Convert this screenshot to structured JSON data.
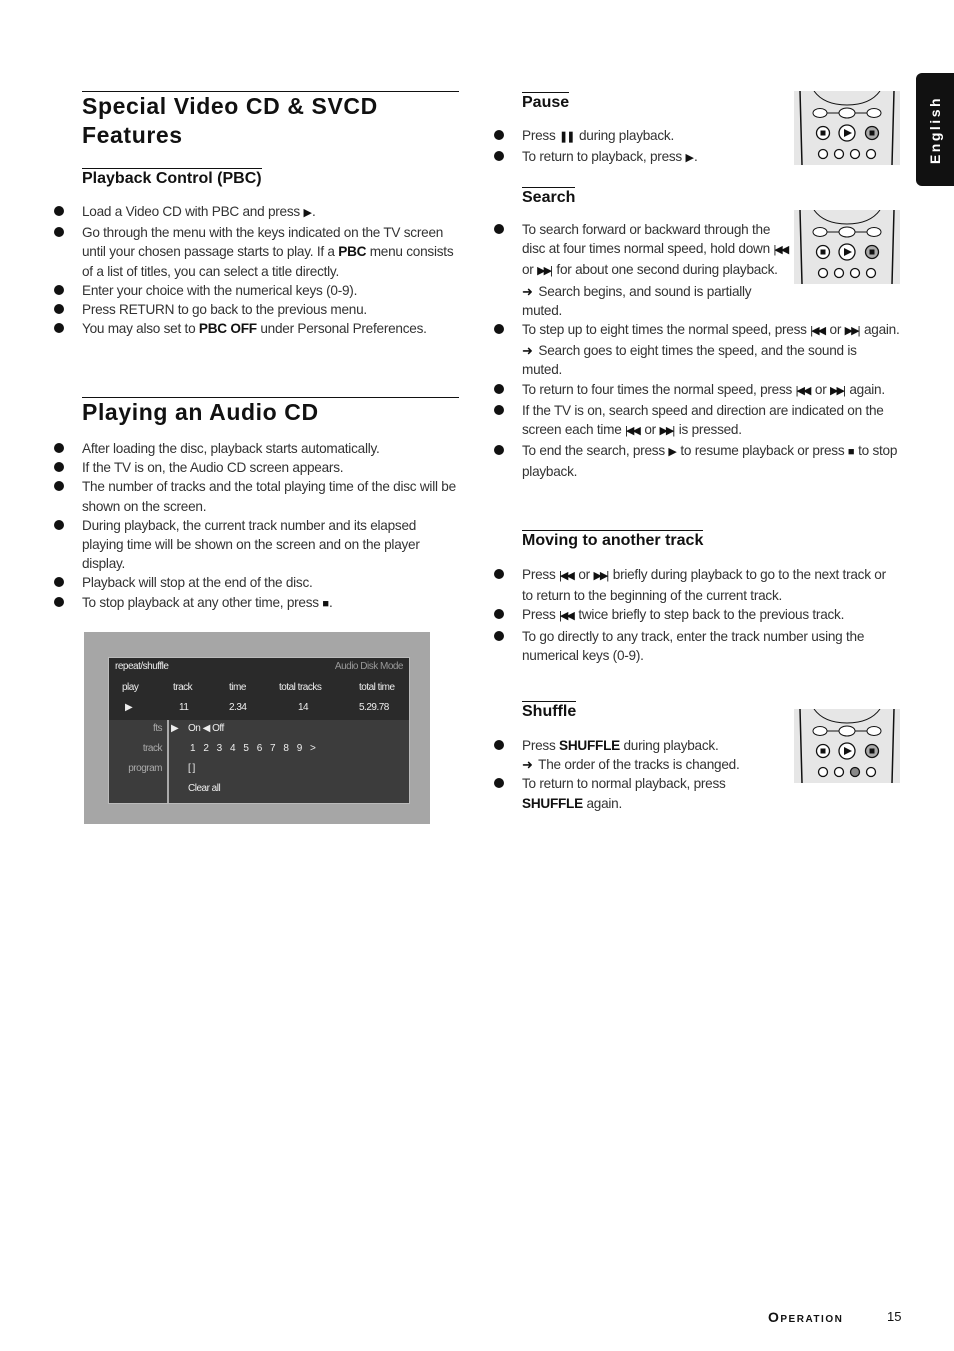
{
  "side_tab": "English",
  "left": {
    "pbc_section": {
      "title": "Special Video CD & SVCD Features",
      "subtitle": "Playback Control (PBC)",
      "items": [
        [
          [
            "Load a Video CD with PBC and press "
          ],
          {
            "icon": "play"
          },
          [
            "."
          ]
        ],
        [
          [
            "Go through the menu with the keys indicated on the TV screen until your chosen passage starts to play. If a "
          ],
          {
            "b": "PBC"
          },
          [
            " menu consists of a list of titles, you can select a title directly."
          ]
        ],
        [
          [
            "Enter your choice with the numerical keys (0-9)."
          ]
        ],
        [
          [
            "Press RETURN to go back to the previous menu."
          ]
        ],
        [
          [
            "You may also set to "
          ],
          {
            "b": "PBC OFF"
          },
          [
            " under Personal Preferences."
          ]
        ]
      ]
    },
    "audio_section": {
      "title": "Playing an Audio CD",
      "items": [
        [
          [
            "After loading the disc, playback starts automatically."
          ]
        ],
        [
          [
            "If the TV is on, the Audio CD screen appears."
          ]
        ],
        [
          [
            "The number of tracks and the total playing time of the disc will be shown on the screen."
          ]
        ],
        [
          [
            "During playback, the current track number and its elapsed playing time will be shown on the screen and on the player display."
          ]
        ],
        [
          [
            "Playback will stop at the end of the disc."
          ]
        ],
        [
          [
            "To stop playback at any other time, press "
          ],
          {
            "icon": "stop"
          },
          [
            "."
          ]
        ]
      ]
    },
    "osd": {
      "header": "repeat/shuffle",
      "mode": "Audio Disk Mode",
      "columns": [
        "play",
        "track",
        "time",
        "total tracks",
        "total time"
      ],
      "values": {
        "track": "11",
        "time": "2.34",
        "total_tracks": "14",
        "total_time": "5.29.78"
      },
      "rows": {
        "fts_label": "fts",
        "fts_value": "On ◀ Off",
        "track_label": "track",
        "tracks": [
          "1",
          "2",
          "3",
          "4",
          "5",
          "6",
          "7",
          "8",
          "9",
          ">"
        ],
        "program_label": "program",
        "program_value": "[ ]",
        "clear": "Clear all"
      }
    }
  },
  "right": {
    "pause": {
      "title": "Pause",
      "items": [
        [
          [
            "Press "
          ],
          {
            "icon": "pause"
          },
          [
            " during playback."
          ]
        ],
        [
          [
            "To return to playback, press "
          ],
          {
            "icon": "play"
          },
          [
            "."
          ]
        ]
      ]
    },
    "search": {
      "title": "Search",
      "items": [
        [
          [
            "To search forward or backward through the disc at four times normal speed, hold down "
          ],
          {
            "icon": "prev"
          },
          [
            " or "
          ],
          {
            "icon": "next"
          },
          [
            " for about one second during playback."
          ],
          {
            "br": 1
          },
          {
            "icon": "arrow"
          },
          [
            " Search begins, and sound is partially muted."
          ]
        ],
        [
          [
            "To step up to eight times the normal speed, press "
          ],
          {
            "icon": "prev"
          },
          [
            " or "
          ],
          {
            "icon": "next"
          },
          [
            " again."
          ],
          {
            "br": 1
          },
          {
            "icon": "arrow"
          },
          [
            " Search goes to eight times the speed, and the sound is muted."
          ]
        ],
        [
          [
            "To return to four times the normal speed, press "
          ],
          {
            "icon": "prev"
          },
          [
            " or "
          ],
          {
            "icon": "next"
          },
          [
            " again."
          ]
        ],
        [
          [
            "If the TV is on, search speed and direction are indicated on the screen each time "
          ],
          {
            "icon": "prev"
          },
          [
            " or "
          ],
          {
            "icon": "next"
          },
          [
            " is pressed."
          ]
        ],
        [
          [
            "To end the search, press "
          ],
          {
            "icon": "play"
          },
          [
            " to resume playback or press "
          ],
          {
            "icon": "stop"
          },
          [
            " to stop playback."
          ]
        ]
      ]
    },
    "moving": {
      "title": "Moving to another track",
      "items": [
        [
          [
            "Press "
          ],
          {
            "icon": "prev"
          },
          [
            " or "
          ],
          {
            "icon": "next"
          },
          [
            " briefly during playback to go to the next track or to return to the beginning of the current track."
          ]
        ],
        [
          [
            "Press "
          ],
          {
            "icon": "prev"
          },
          [
            " twice briefly to step back to the previous track."
          ]
        ],
        [
          [
            "To go directly to any track, enter the track number using the numerical keys (0-9)."
          ]
        ]
      ]
    },
    "shuffle": {
      "title": "Shuffle",
      "items": [
        [
          [
            "Press "
          ],
          {
            "b": "SHUFFLE"
          },
          [
            " during playback."
          ],
          {
            "br": 1
          },
          {
            "icon": "arrow"
          },
          [
            " The order of the tracks is changed."
          ]
        ],
        [
          [
            "To return to normal playback, press "
          ],
          {
            "b": "SHUFFLE"
          },
          [
            " again."
          ]
        ]
      ]
    }
  },
  "footer": {
    "section": "Operation",
    "page": "15"
  }
}
